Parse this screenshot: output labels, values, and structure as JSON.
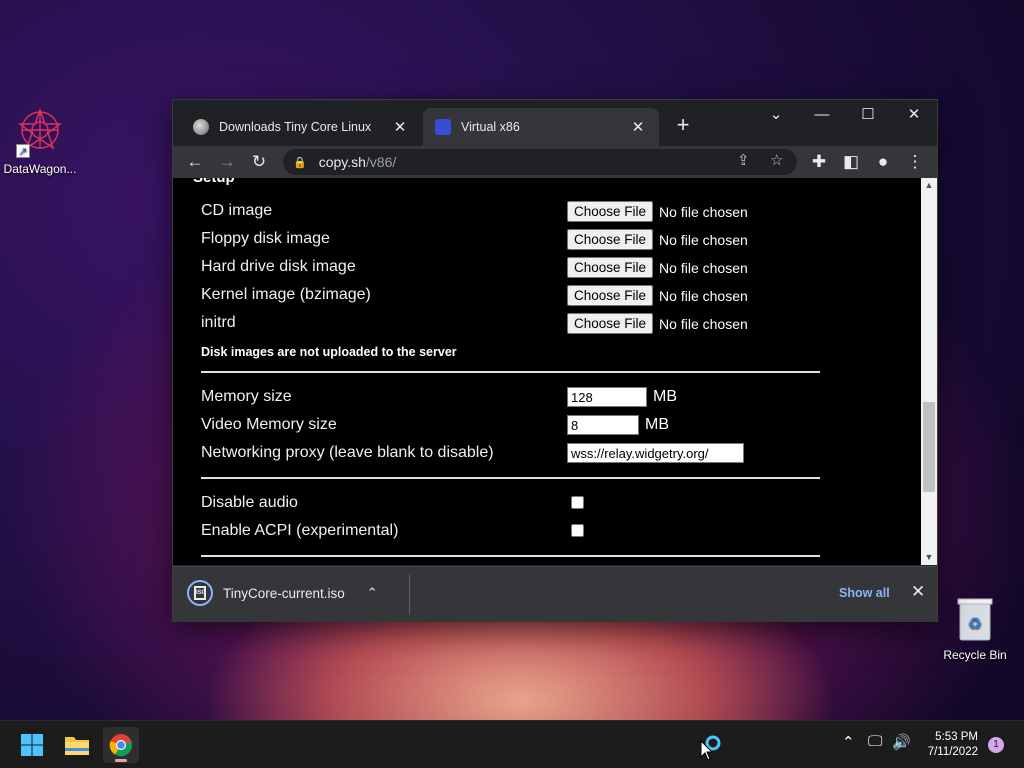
{
  "desktop": {
    "icons": [
      {
        "label": "DataWagon..."
      },
      {
        "label": "Recycle Bin"
      }
    ]
  },
  "browser": {
    "tabs": [
      {
        "title": "Downloads Tiny Core Linux",
        "active": false
      },
      {
        "title": "Virtual x86",
        "active": true
      }
    ],
    "new_tab": "+",
    "controls": {
      "minimize": "—",
      "maximize": "☐",
      "close": "✕",
      "tab_list": "⌄"
    },
    "address": {
      "host": "copy.sh",
      "path": "/v86/"
    },
    "nav": {
      "back": "←",
      "forward": "→",
      "reload": "↻"
    }
  },
  "page": {
    "section_title": "Setup",
    "file_rows": [
      {
        "label": "CD image",
        "button": "Choose File",
        "status": "No file chosen"
      },
      {
        "label": "Floppy disk image",
        "button": "Choose File",
        "status": "No file chosen"
      },
      {
        "label": "Hard drive disk image",
        "button": "Choose File",
        "status": "No file chosen"
      },
      {
        "label": "Kernel image (bzimage)",
        "button": "Choose File",
        "status": "No file chosen"
      },
      {
        "label": "initrd",
        "button": "Choose File",
        "status": "No file chosen"
      }
    ],
    "note": "Disk images are not uploaded to the server",
    "memory": {
      "label": "Memory size",
      "value": "128",
      "unit": "MB"
    },
    "video_memory": {
      "label": "Video Memory size",
      "value": "8",
      "unit": "MB"
    },
    "proxy": {
      "label": "Networking proxy (leave blank to disable)",
      "value": "wss://relay.widgetry.org/"
    },
    "disable_audio": {
      "label": "Disable audio",
      "checked": false
    },
    "enable_acpi": {
      "label": "Enable ACPI (experimental)",
      "checked": false
    }
  },
  "download_bar": {
    "file_name": "TinyCore-current.iso",
    "icon_text": "ISO",
    "show_all": "Show all"
  },
  "taskbar": {
    "time": "5:53 PM",
    "date": "7/11/2022",
    "notification_count": "1"
  }
}
